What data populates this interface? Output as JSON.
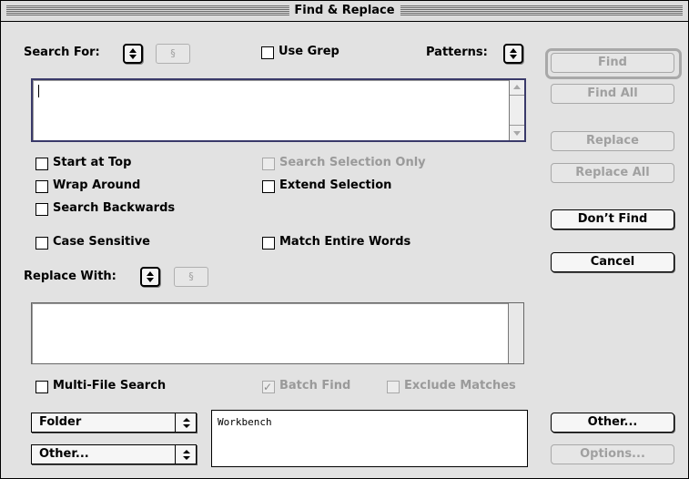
{
  "window": {
    "title": "Find & Replace"
  },
  "search": {
    "label": "Search For:",
    "special_button": "§",
    "use_grep": "Use Grep",
    "patterns": "Patterns:",
    "value": ""
  },
  "options": {
    "start_at_top": "Start at Top",
    "wrap_around": "Wrap Around",
    "search_backwards": "Search Backwards",
    "case_sensitive": "Case Sensitive",
    "search_selection_only": "Search Selection Only",
    "extend_selection": "Extend Selection",
    "match_entire_words": "Match Entire Words"
  },
  "replace": {
    "label": "Replace With:",
    "special_button": "§",
    "value": ""
  },
  "multi": {
    "multi_file_search": "Multi-File Search",
    "batch_find": "Batch Find",
    "exclude_matches": "Exclude Matches"
  },
  "selects": {
    "source": "Folder",
    "other": "Other..."
  },
  "file_list": [
    "Workbench"
  ],
  "buttons": {
    "find": "Find",
    "find_all": "Find All",
    "replace": "Replace",
    "replace_all": "Replace All",
    "dont_find": "Don’t Find",
    "cancel": "Cancel",
    "other": "Other...",
    "options": "Options..."
  }
}
